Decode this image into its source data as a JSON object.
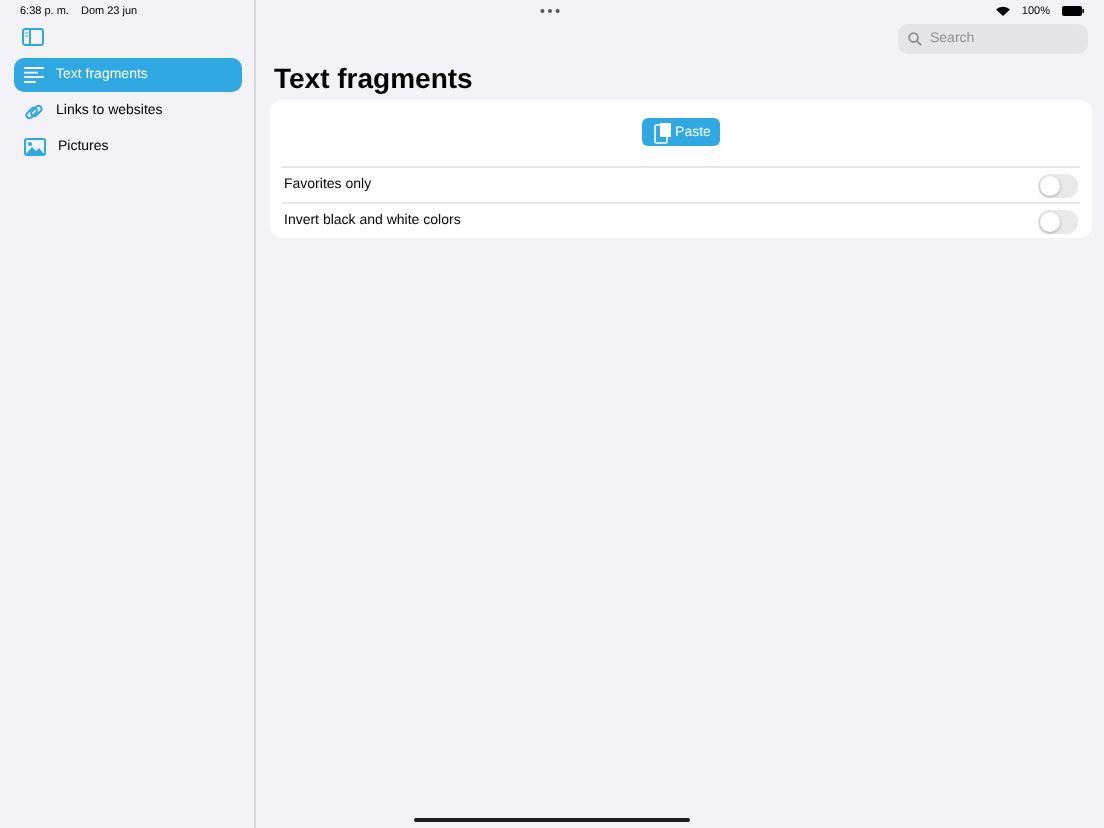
{
  "status_bar": {
    "time": "6:38 p. m.",
    "date": "Dom 23 jun",
    "battery": "100%"
  },
  "sidebar": {
    "items": [
      {
        "label": "Text fragments",
        "kind": "text",
        "selected": true
      },
      {
        "label": "Links to websites",
        "kind": "link",
        "selected": false
      },
      {
        "label": "Pictures",
        "kind": "picture",
        "selected": false
      }
    ]
  },
  "search": {
    "placeholder": "Search"
  },
  "title": "Text fragments",
  "paste_button": "Paste",
  "toggles": [
    {
      "label": "Favorites only",
      "on": false
    },
    {
      "label": "Invert black and white colors",
      "on": false
    }
  ]
}
